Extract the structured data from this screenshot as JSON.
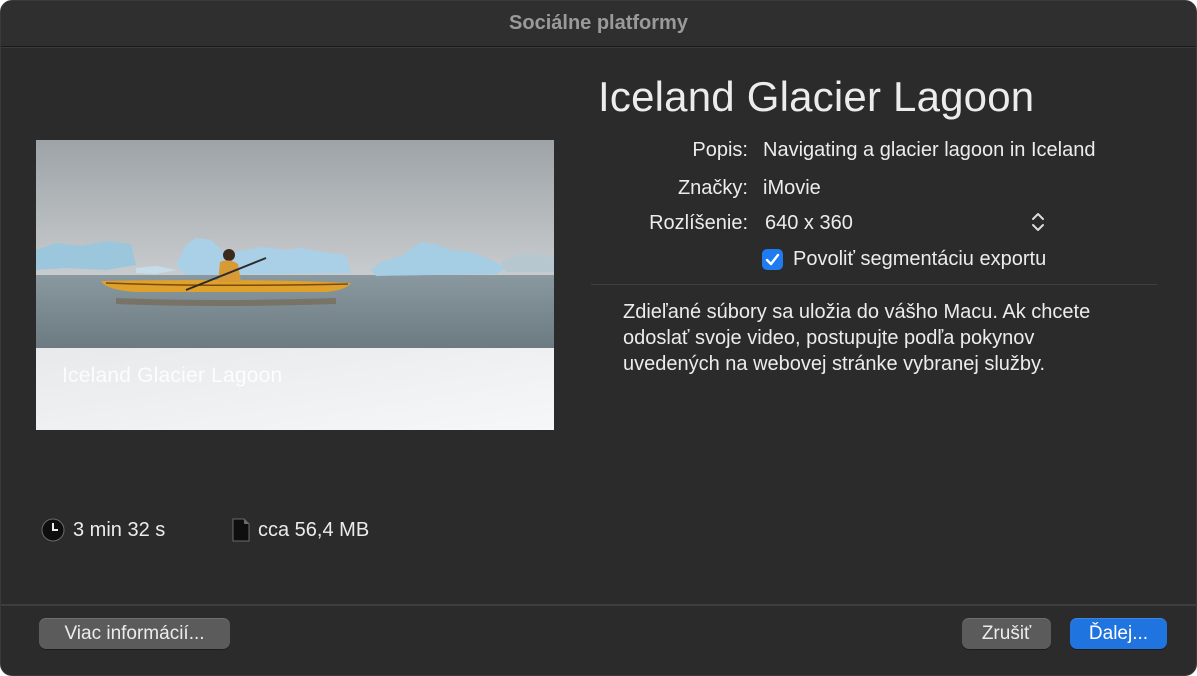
{
  "window": {
    "title": "Sociálne platformy"
  },
  "preview": {
    "overlay_title": "Iceland Glacier Lagoon",
    "duration": "3 min 32 s",
    "size": "cca 56,4 MB"
  },
  "details": {
    "title": "Iceland Glacier Lagoon",
    "description_label": "Popis:",
    "description_value": "Navigating a glacier lagoon in Iceland",
    "tags_label": "Značky:",
    "tags_value": "iMovie",
    "resolution_label": "Rozlíšenie:",
    "resolution_value": "640 x 360",
    "segmentation_label": "Povoliť segmentáciu exportu",
    "segmentation_checked": true,
    "info_lines": [
      "Zdieľané súbory sa uložia do vášho Macu. Ak chcete",
      "odoslať svoje video, postupujte podľa pokynov",
      "uvedených na webovej stránke vybranej služby."
    ]
  },
  "buttons": {
    "more_info": "Viac informácií...",
    "cancel": "Zrušiť",
    "next": "Ďalej..."
  },
  "colors": {
    "window_bg": "#2b2b2b",
    "accent": "#1f74e0",
    "button_gray": "#5b5b5b"
  },
  "icons": {
    "duration": "clock-icon",
    "size": "document-icon",
    "resolution_popup": "chevron-up-down-icon",
    "checkbox": "checkmark-icon"
  }
}
